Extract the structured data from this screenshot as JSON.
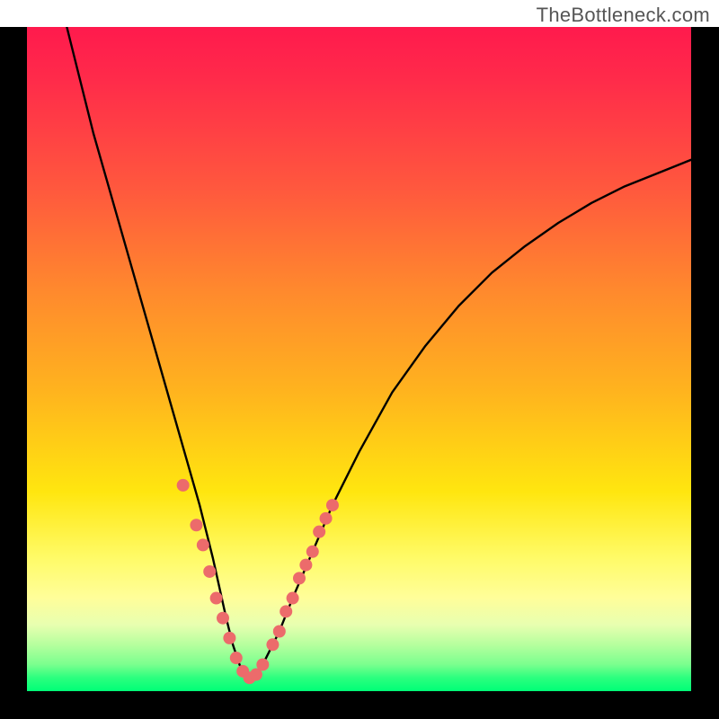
{
  "watermark": "TheBottleneck.com",
  "colors": {
    "frame": "#000000",
    "curve": "#000000",
    "dot_fill": "#ec6b6b",
    "gradient_top": "#ff1a4d",
    "gradient_bottom": "#00ff77"
  },
  "chart_data": {
    "type": "line",
    "title": "",
    "xlabel": "",
    "ylabel": "",
    "xlim": [
      0,
      100
    ],
    "ylim": [
      0,
      100
    ],
    "grid": false,
    "legend": false,
    "description": "Bottleneck-style V-shaped curve over a vertical rainbow gradient (red at top to green at bottom). Curve minimum is near x≈33. The right branch rises toward upper-right but does not reach the top. Pink circular markers cluster along both branches near the valley/green band region.",
    "series": [
      {
        "name": "curve",
        "color": "#000000",
        "x": [
          6,
          8,
          10,
          12,
          14,
          16,
          18,
          20,
          22,
          24,
          26,
          28,
          30,
          31,
          32,
          33,
          34,
          35,
          36,
          38,
          40,
          43,
          46,
          50,
          55,
          60,
          65,
          70,
          75,
          80,
          85,
          90,
          95,
          100
        ],
        "y": [
          100,
          92,
          84,
          77,
          70,
          63,
          56,
          49,
          42,
          35,
          28,
          20,
          11,
          7,
          4,
          2,
          2,
          3,
          5,
          9,
          14,
          21,
          28,
          36,
          45,
          52,
          58,
          63,
          67,
          70.5,
          73.5,
          76,
          78,
          80
        ]
      }
    ],
    "markers": [
      {
        "name": "dots",
        "color": "#ec6b6b",
        "radius": 7,
        "points": [
          {
            "x": 23.5,
            "y": 31
          },
          {
            "x": 25.5,
            "y": 25
          },
          {
            "x": 26.5,
            "y": 22
          },
          {
            "x": 27.5,
            "y": 18
          },
          {
            "x": 28.5,
            "y": 14
          },
          {
            "x": 29.5,
            "y": 11
          },
          {
            "x": 30.5,
            "y": 8
          },
          {
            "x": 31.5,
            "y": 5
          },
          {
            "x": 32.5,
            "y": 3
          },
          {
            "x": 33.5,
            "y": 2
          },
          {
            "x": 34.5,
            "y": 2.5
          },
          {
            "x": 35.5,
            "y": 4
          },
          {
            "x": 37.0,
            "y": 7
          },
          {
            "x": 38.0,
            "y": 9
          },
          {
            "x": 39.0,
            "y": 12
          },
          {
            "x": 40.0,
            "y": 14
          },
          {
            "x": 41.0,
            "y": 17
          },
          {
            "x": 42.0,
            "y": 19
          },
          {
            "x": 43.0,
            "y": 21
          },
          {
            "x": 44.0,
            "y": 24
          },
          {
            "x": 45.0,
            "y": 26
          },
          {
            "x": 46.0,
            "y": 28
          }
        ]
      }
    ]
  }
}
